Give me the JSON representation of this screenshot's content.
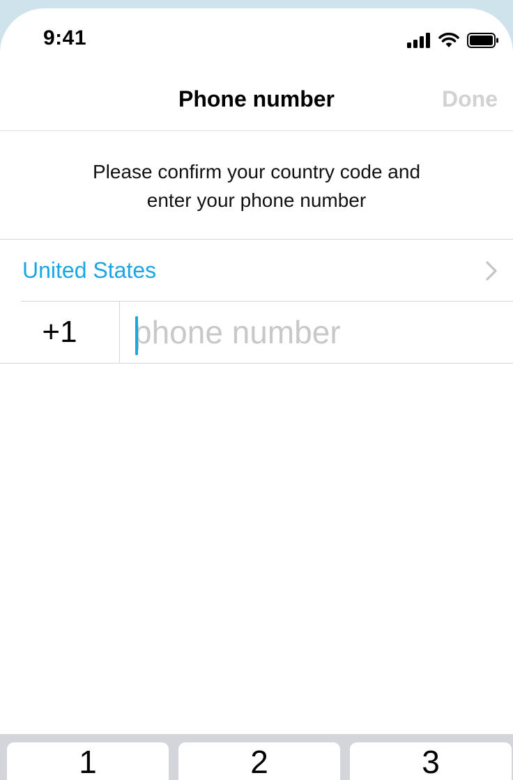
{
  "status_bar": {
    "time": "9:41",
    "icons": [
      "signal-icon",
      "wifi-icon",
      "battery-icon"
    ]
  },
  "nav": {
    "title": "Phone number",
    "done_label": "Done"
  },
  "instructions": {
    "line1": "Please confirm your country code and",
    "line2": "enter your phone number"
  },
  "country": {
    "name": "United States",
    "code": "+1"
  },
  "phone_input": {
    "value": "",
    "placeholder": "phone number"
  },
  "keyboard": {
    "keys": [
      "1",
      "2",
      "3"
    ]
  },
  "colors": {
    "accent": "#1aa6e4",
    "done_disabled": "#d2d2d2",
    "separator": "#d6d6d6",
    "keyboard_bg": "#d3d5da",
    "outer_bg": "#cfe3ec"
  }
}
